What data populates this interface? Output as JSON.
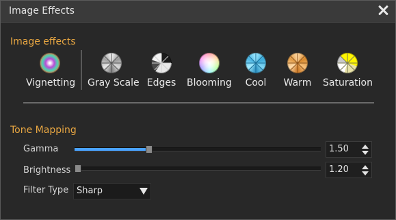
{
  "window": {
    "title": "Image Effects"
  },
  "sections": {
    "image_effects": "Image effects",
    "tone_mapping": "Tone Mapping"
  },
  "effects": [
    {
      "label": "Vignetting",
      "icon": "vignetting-icon"
    },
    {
      "label": "Gray Scale",
      "icon": "grayscale-icon"
    },
    {
      "label": "Edges",
      "icon": "edges-icon"
    },
    {
      "label": "Blooming",
      "icon": "blooming-icon"
    },
    {
      "label": "Cool",
      "icon": "cool-icon"
    },
    {
      "label": "Warm",
      "icon": "warm-icon"
    },
    {
      "label": "Saturation",
      "icon": "saturation-icon"
    }
  ],
  "tone": {
    "gamma": {
      "label": "Gamma",
      "value": "1.50",
      "level": 0.3
    },
    "brightness": {
      "label": "Brightness",
      "value": "1.20",
      "level": 0.01
    },
    "filter": {
      "label": "Filter Type",
      "selected": "Sharp"
    }
  },
  "colors": {
    "accent": "#e9a742",
    "slider_fill": "#4aa3ff",
    "background": "#282828"
  }
}
